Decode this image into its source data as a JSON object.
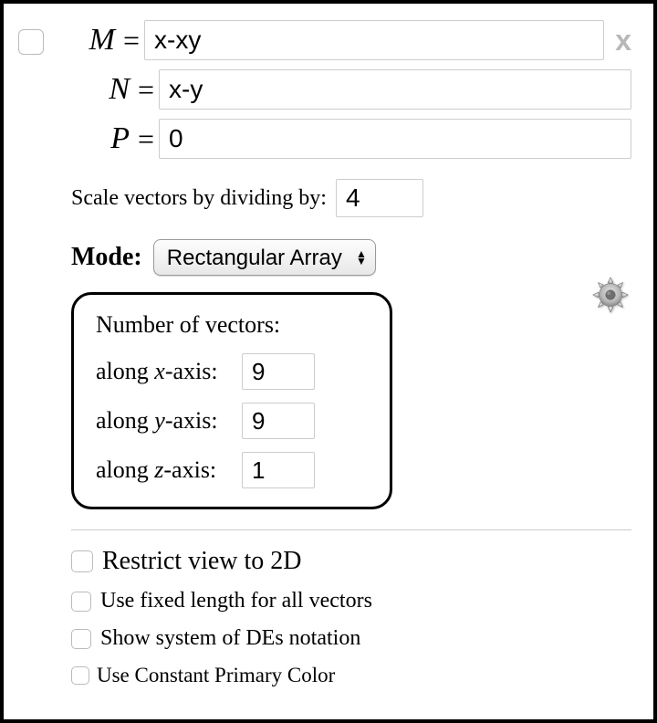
{
  "close_label": "x",
  "eq": {
    "m_label": "M",
    "m_value": "x-xy",
    "n_label": "N",
    "n_value": "x-y",
    "p_label": "P",
    "p_value": "0",
    "equals": "="
  },
  "scale": {
    "label": "Scale vectors by dividing by:",
    "value": "4"
  },
  "mode": {
    "label": "Mode:",
    "selected": "Rectangular Array"
  },
  "vectors": {
    "title": "Number of vectors:",
    "x_label_pre": "along ",
    "x_var": "x",
    "x_label_post": "-axis:",
    "x_value": "9",
    "y_label_pre": "along ",
    "y_var": "y",
    "y_label_post": "-axis:",
    "y_value": "9",
    "z_label_pre": "along ",
    "z_var": "z",
    "z_label_post": "-axis:",
    "z_value": "1"
  },
  "options": {
    "restrict2d": "Restrict view to 2D",
    "fixed_length": "Use fixed length for all vectors",
    "show_de": "Show system of DEs notation",
    "constant_color": "Use Constant Primary Color"
  }
}
